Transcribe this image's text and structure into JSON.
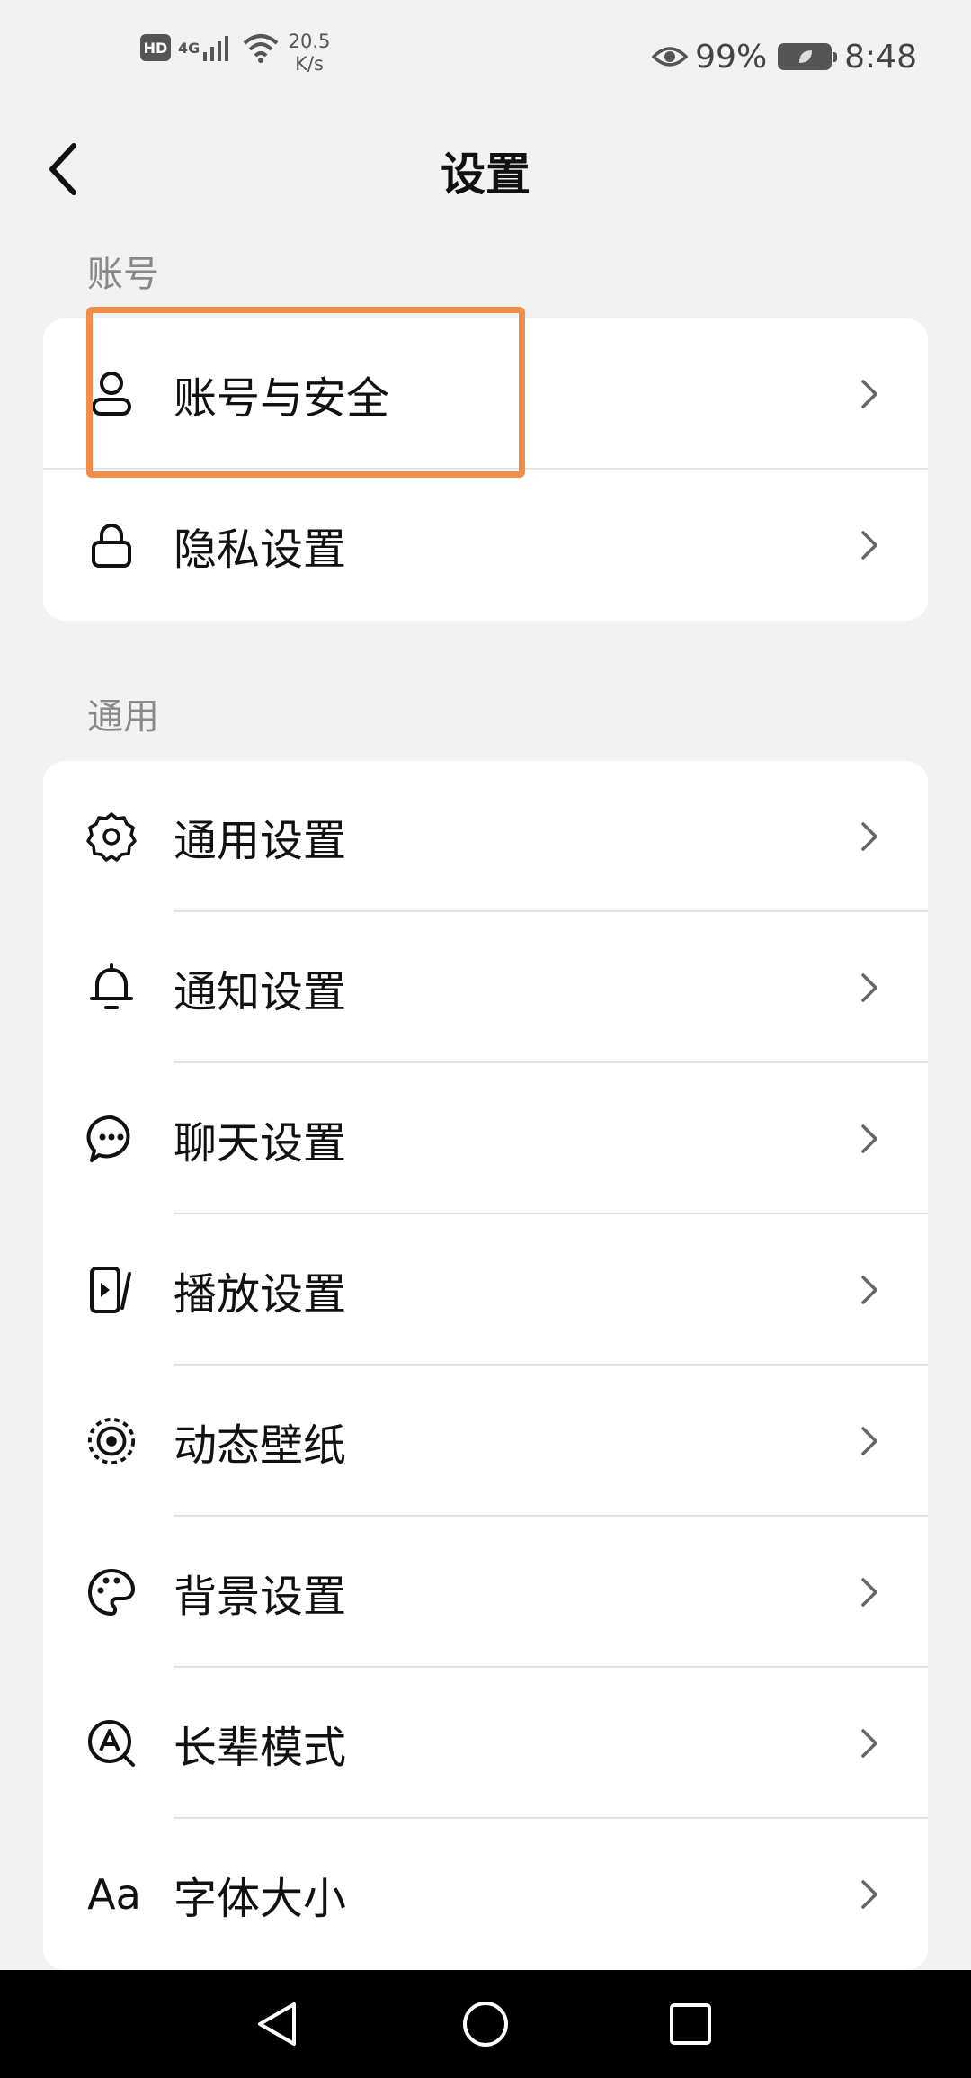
{
  "status_bar": {
    "hd": "HD",
    "network": "4G",
    "speed_value": "20.5",
    "speed_unit": "K/s",
    "battery_percent": "99%",
    "time": "8:48"
  },
  "header": {
    "title": "设置"
  },
  "sections": {
    "account": {
      "label": "账号",
      "items": [
        {
          "label": "账号与安全",
          "icon": "user-icon"
        },
        {
          "label": "隐私设置",
          "icon": "lock-icon"
        }
      ]
    },
    "general": {
      "label": "通用",
      "items": [
        {
          "label": "通用设置",
          "icon": "gear-icon"
        },
        {
          "label": "通知设置",
          "icon": "bell-icon"
        },
        {
          "label": "聊天设置",
          "icon": "chat-bubble-icon"
        },
        {
          "label": "播放设置",
          "icon": "play-icon"
        },
        {
          "label": "动态壁纸",
          "icon": "live-wallpaper-icon"
        },
        {
          "label": "背景设置",
          "icon": "palette-icon"
        },
        {
          "label": "长辈模式",
          "icon": "elder-mode-icon"
        },
        {
          "label": "字体大小",
          "icon": "font-size-icon",
          "icon_text": "Aa"
        }
      ]
    }
  },
  "colors": {
    "background": "#f2f2f2",
    "card": "#ffffff",
    "highlight": "#ef8f4b",
    "section_label": "#888888"
  }
}
